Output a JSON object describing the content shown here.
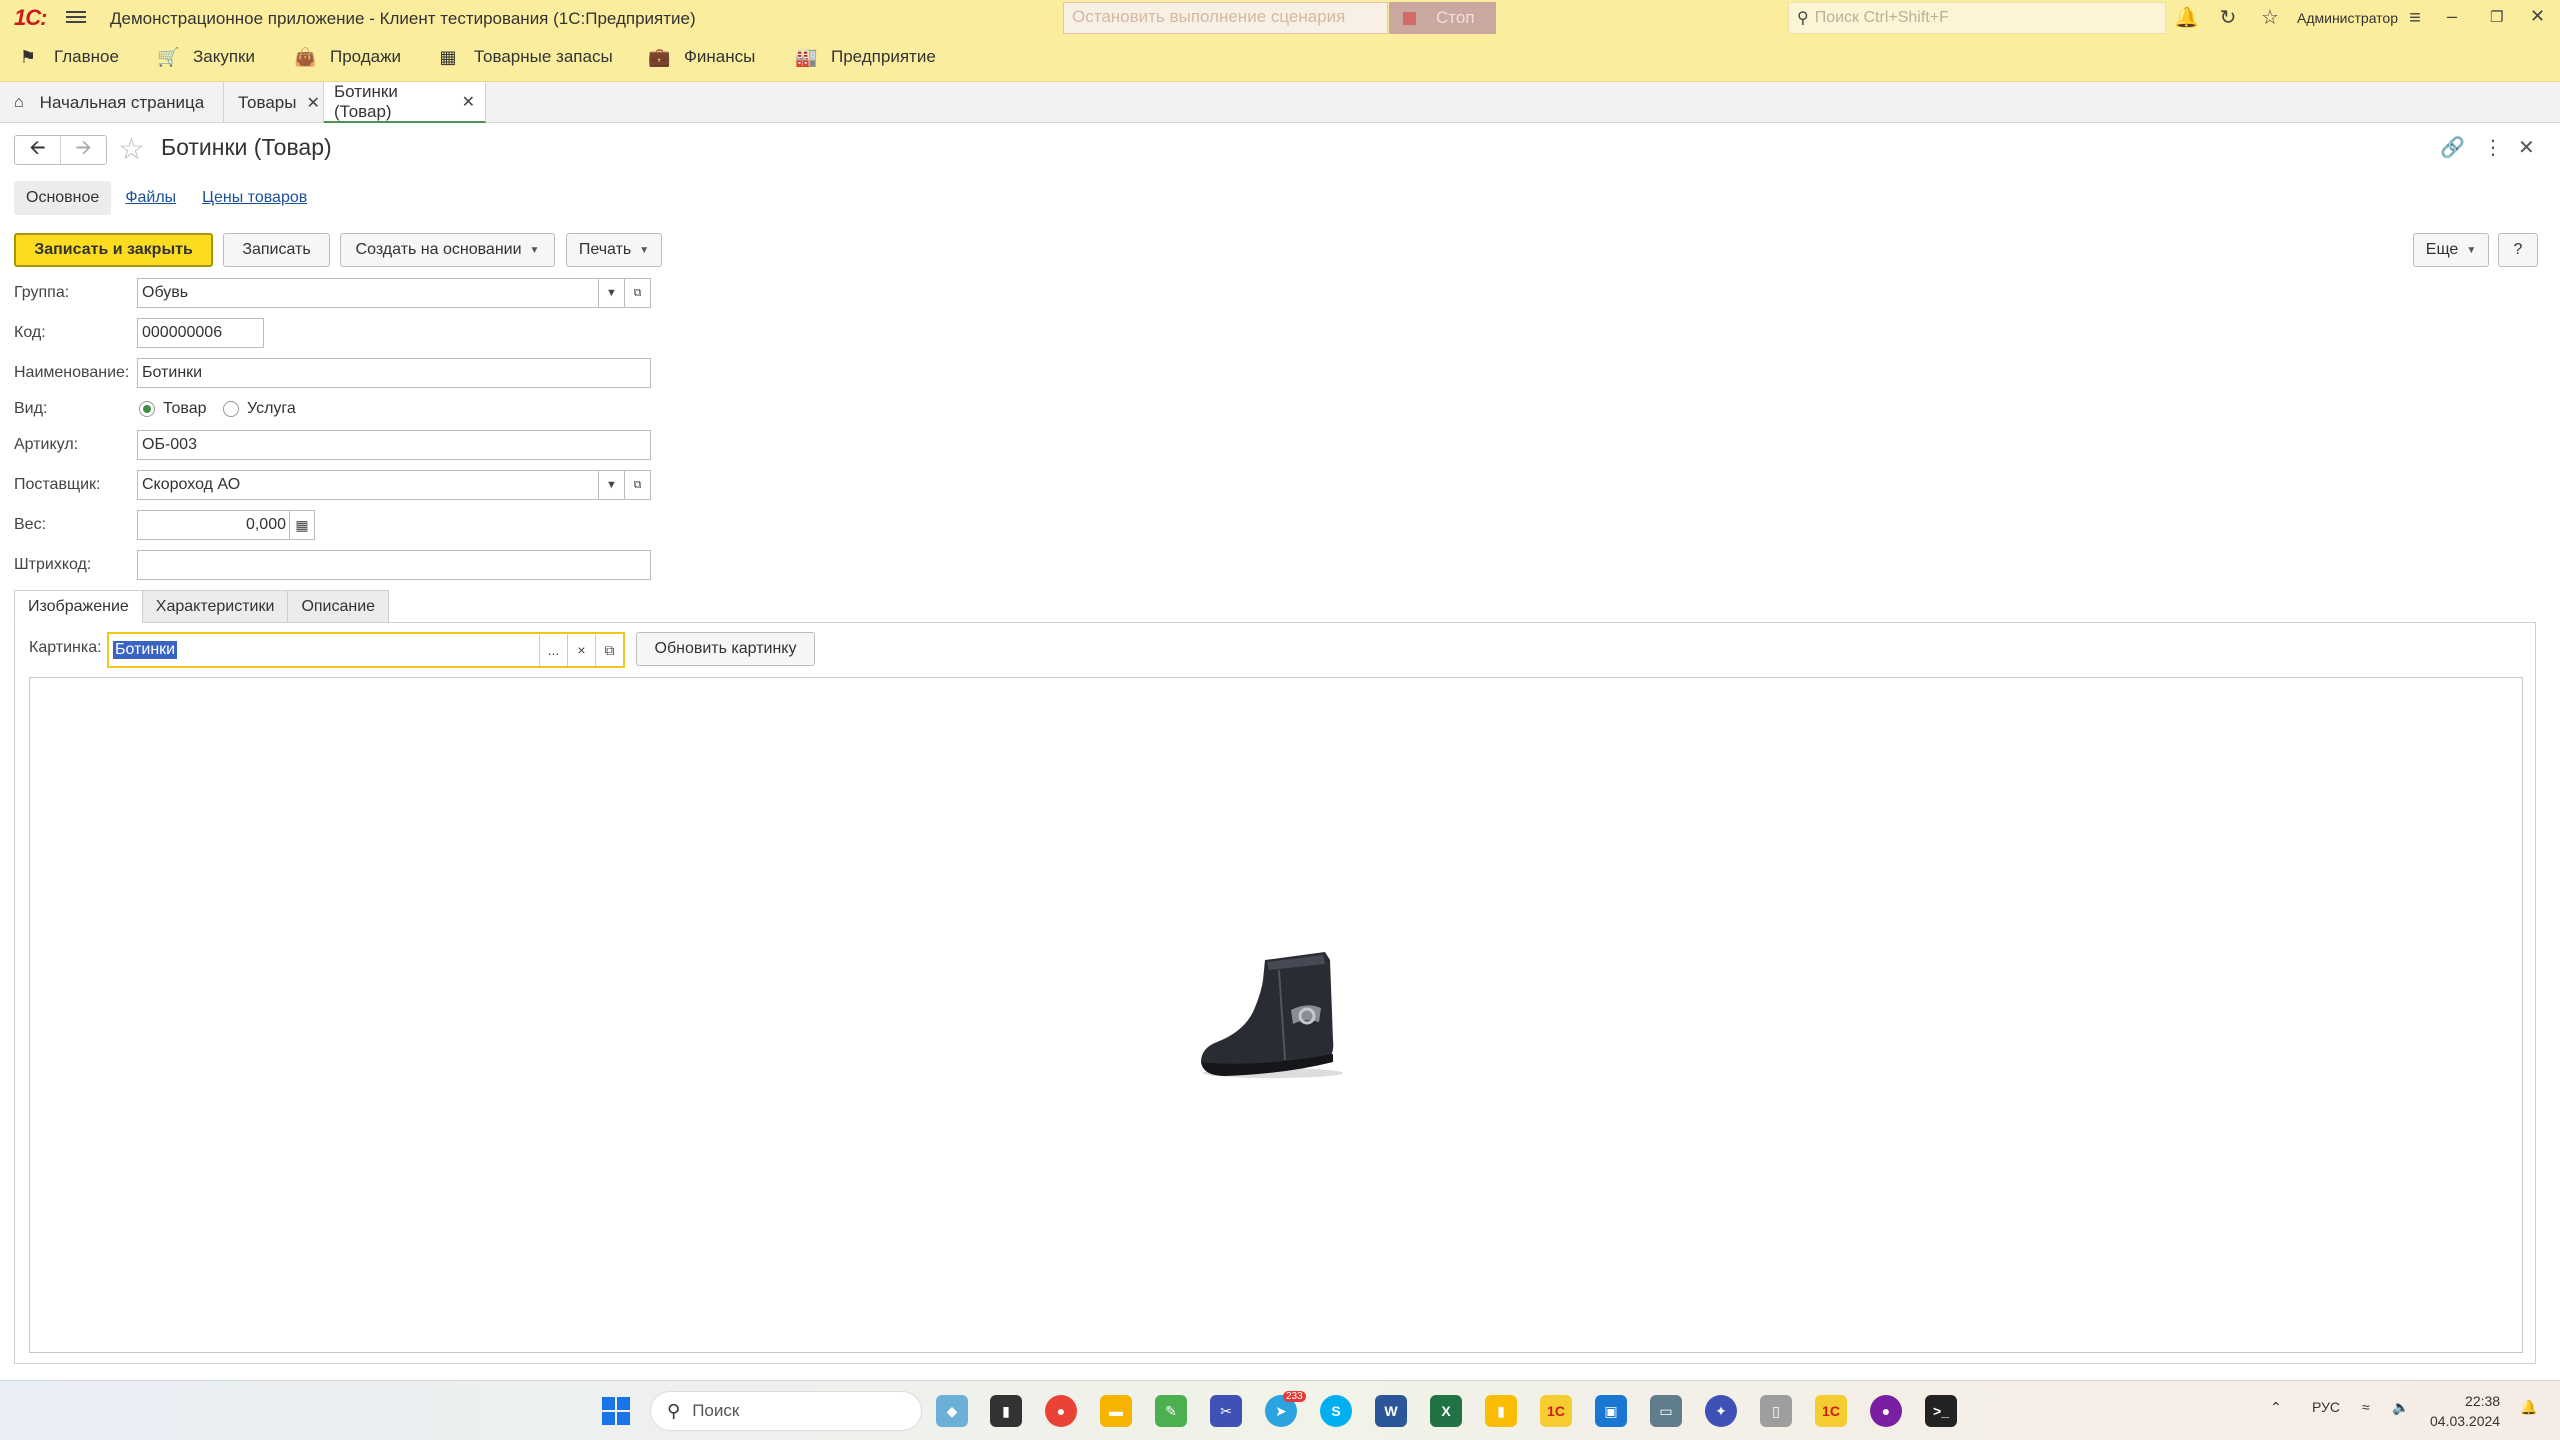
{
  "titlebar": {
    "app_title": "Демонстрационное приложение  - Клиент тестирования (1С:Предприятие)",
    "scenario_placeholder": "Остановить выполнение сценария",
    "stop_label": "Стоп",
    "search_placeholder": "Поиск Ctrl+Shift+F",
    "user": "Администратор"
  },
  "sections": [
    {
      "label": "Главное",
      "icon": "flag-icon"
    },
    {
      "label": "Закупки",
      "icon": "cart-icon"
    },
    {
      "label": "Продажи",
      "icon": "bag-icon"
    },
    {
      "label": "Товарные запасы",
      "icon": "grid-icon"
    },
    {
      "label": "Финансы",
      "icon": "wallet-icon"
    },
    {
      "label": "Предприятие",
      "icon": "factory-icon"
    }
  ],
  "open_tabs": [
    {
      "label": "Начальная страница",
      "closable": false
    },
    {
      "label": "Товары",
      "closable": true
    },
    {
      "label": "Ботинки (Товар)",
      "closable": true,
      "active": true
    }
  ],
  "form": {
    "title": "Ботинки (Товар)",
    "tabs": {
      "main": "Основное",
      "files": "Файлы",
      "prices": "Цены товаров"
    },
    "commands": {
      "save_close": "Записать и закрыть",
      "save": "Записать",
      "create_based": "Создать на основании",
      "print": "Печать",
      "more": "Еще",
      "help": "?"
    },
    "fields": {
      "group_label": "Группа:",
      "group_value": "Обувь",
      "code_label": "Код:",
      "code_value": "000000006",
      "name_label": "Наименование:",
      "name_value": "Ботинки",
      "kind_label": "Вид:",
      "kind_goods": "Товар",
      "kind_service": "Услуга",
      "article_label": "Артикул:",
      "article_value": "ОБ-003",
      "supplier_label": "Поставщик:",
      "supplier_value": "Скороход АО",
      "weight_label": "Вес:",
      "weight_value": "0,000",
      "barcode_label": "Штрихкод:",
      "barcode_value": ""
    },
    "inner_tabs": {
      "image": "Изображение",
      "characteristics": "Характеристики",
      "description": "Описание"
    },
    "picture": {
      "label": "Картинка:",
      "value": "Ботинки",
      "refresh": "Обновить картинку",
      "choose": "...",
      "clear": "×"
    }
  },
  "taskbar": {
    "search": "Поиск",
    "telegram_badge": "233",
    "lang": "РУС",
    "time": "22:38",
    "date": "04.03.2024"
  },
  "colors": {
    "header_bg": "#fbed9e",
    "primary_button": "#fcdc20",
    "focus_border": "#f3c41a",
    "link": "#1c4f99"
  }
}
